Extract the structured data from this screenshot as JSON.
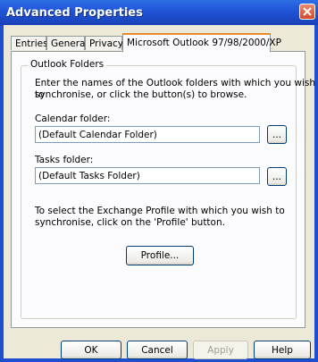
{
  "window": {
    "title": "Advanced Properties"
  },
  "tabs": [
    {
      "label": "Entries"
    },
    {
      "label": "General"
    },
    {
      "label": "Privacy"
    },
    {
      "label": "Microsoft Outlook 97/98/2000/XP"
    }
  ],
  "group": {
    "label": "Outlook Folders",
    "intro_line1": "Enter the names of the Outlook folders with which you wish to",
    "intro_line2": "synchronise, or click the button(s) to browse.",
    "calendar_label": "Calendar folder:",
    "calendar_value": "(Default Calendar Folder)",
    "tasks_label": "Tasks folder:",
    "tasks_value": "(Default Tasks Folder)",
    "browse_label": "...",
    "profile_line1": "To select the Exchange Profile with which you wish to",
    "profile_line2": "synchronise, click on the 'Profile' button.",
    "profile_button": "Profile..."
  },
  "footer": {
    "ok": "OK",
    "cancel": "Cancel",
    "apply": "Apply",
    "help": "Help"
  },
  "icons": {
    "close": "close-icon"
  }
}
